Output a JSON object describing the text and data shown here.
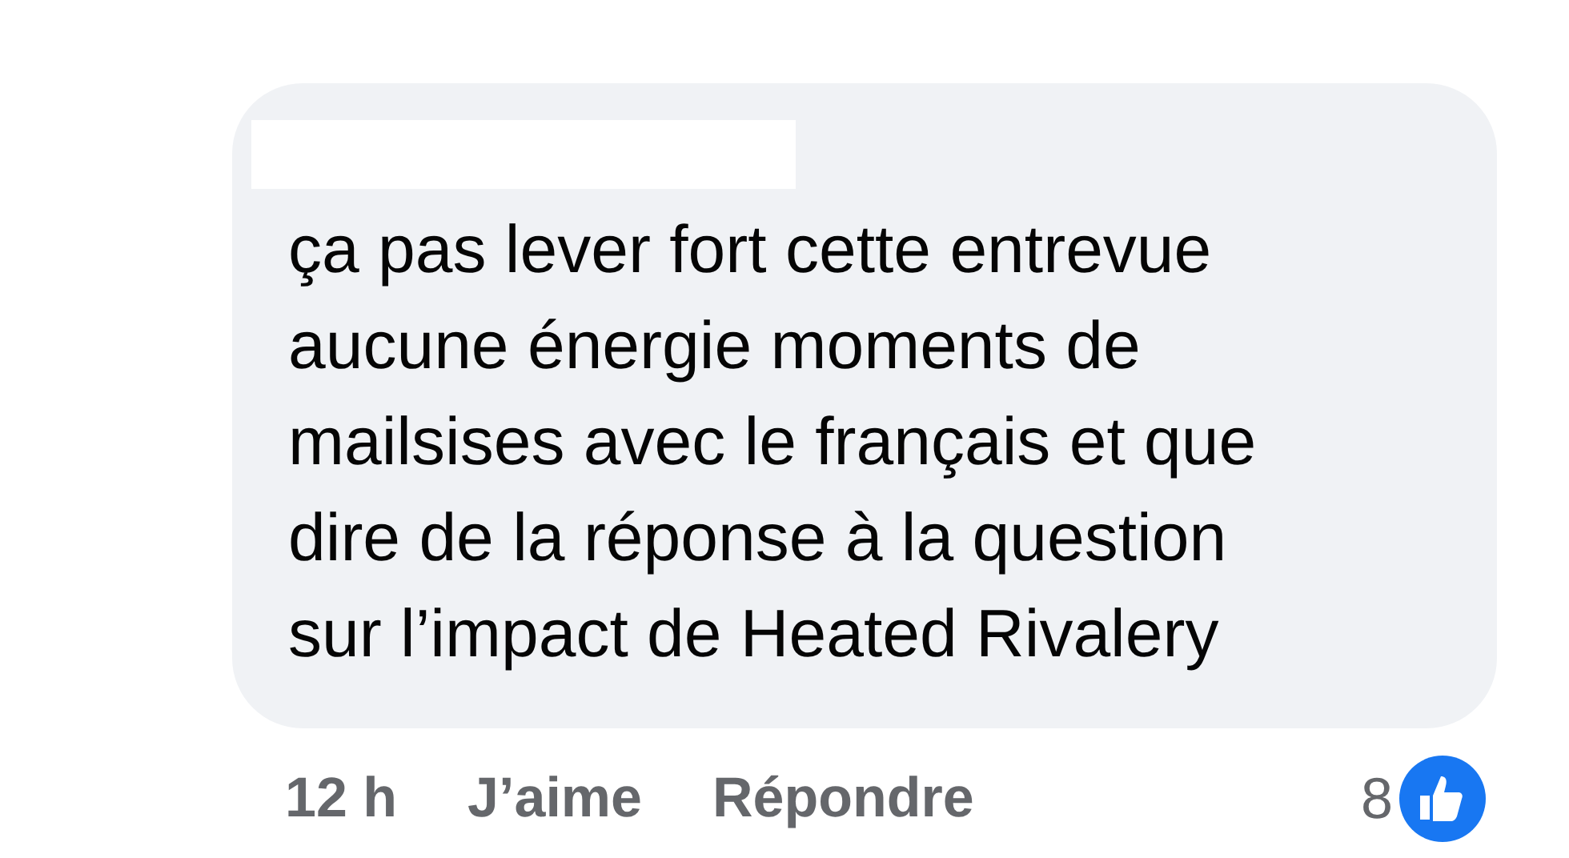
{
  "comment": {
    "lines": [
      "ça pas lever fort cette entrevue",
      "aucune énergie moments de",
      "mailsises avec le français et que",
      "dire de la réponse à la question",
      "sur l’impact de Heated Rivalery"
    ]
  },
  "actions": {
    "time": "12 h",
    "like": "J’aime",
    "reply": "Répondre",
    "reaction_count": "8"
  }
}
